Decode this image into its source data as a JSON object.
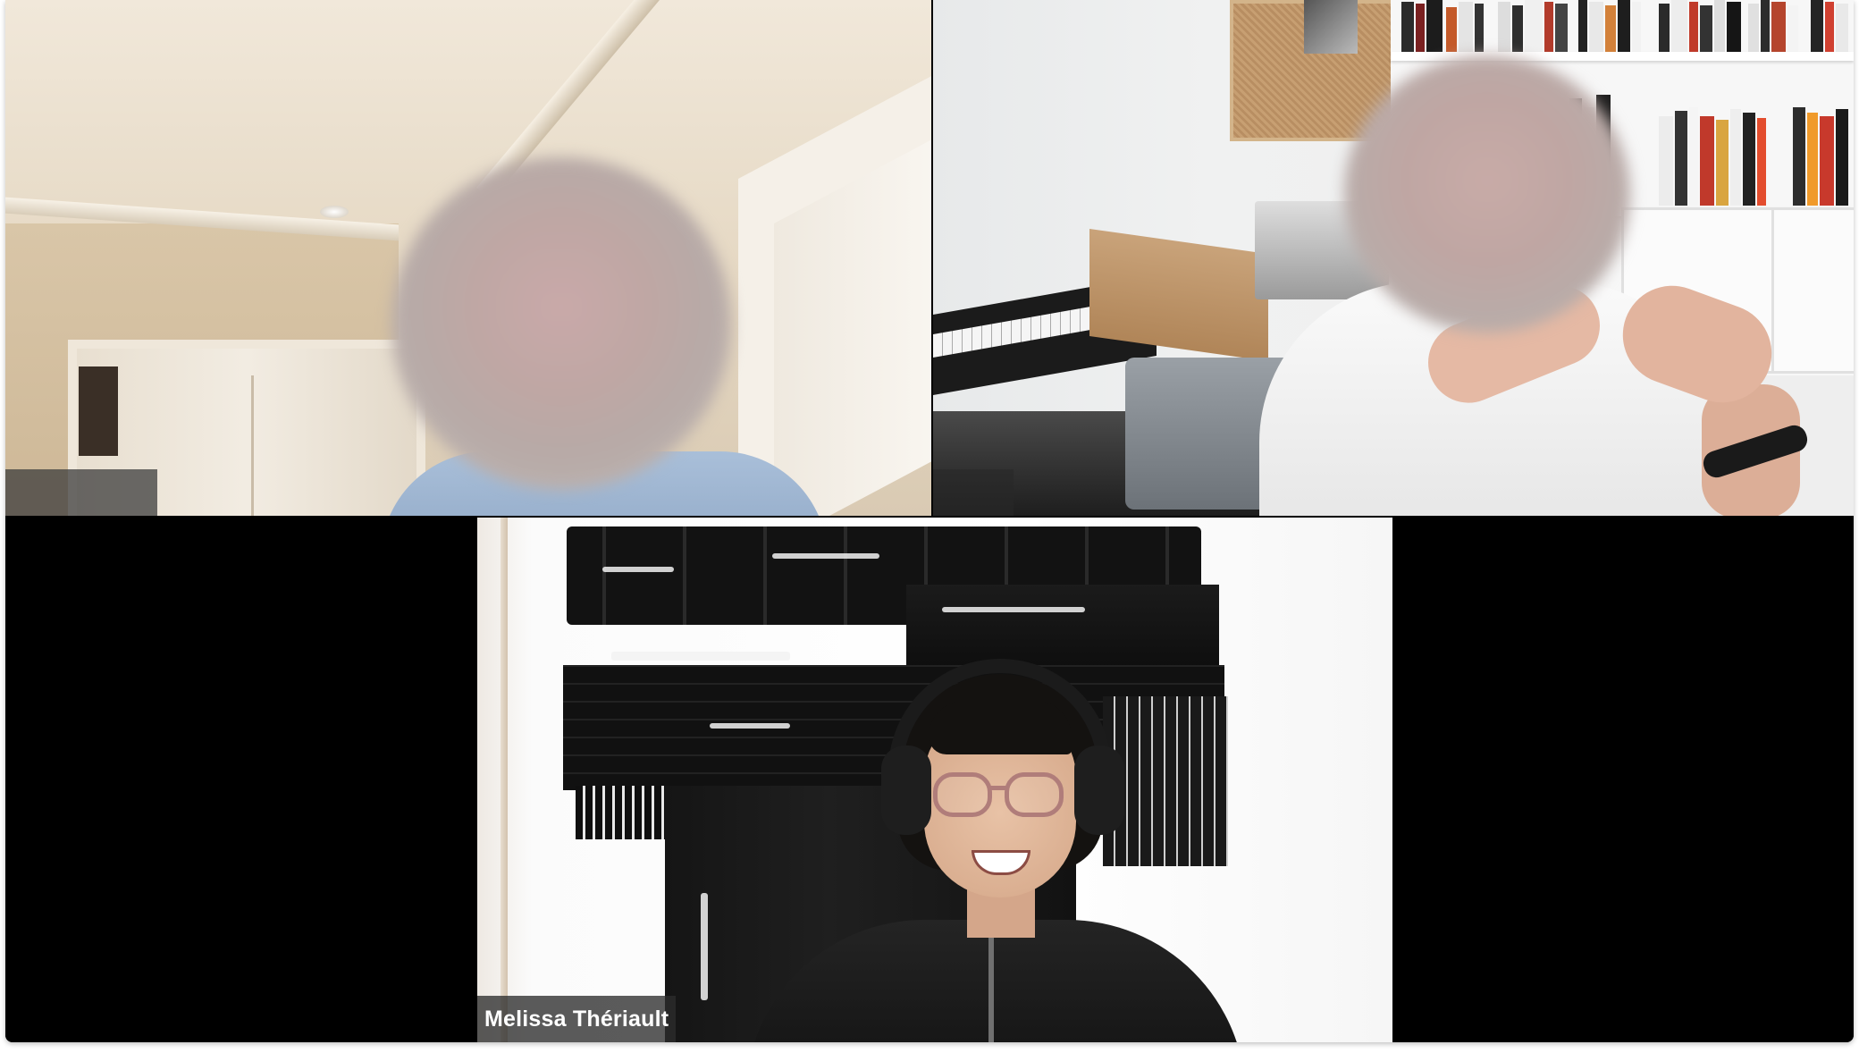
{
  "participants": [
    {
      "name": "",
      "video_on": true,
      "face_blurred": true,
      "background": "room with ceiling trim and closet doors"
    },
    {
      "name": "",
      "video_on": true,
      "face_blurred": true,
      "background": "studio with keyboard, printer and bookshelf"
    },
    {
      "name": "Melissa Thériault",
      "video_on": true,
      "face_blurred": false,
      "background": "white wall with black abstract painting"
    }
  ],
  "colors": {
    "gallery_background": "#000000",
    "name_tag_background": "#2d2d2d",
    "name_tag_text": "#ffffff"
  }
}
